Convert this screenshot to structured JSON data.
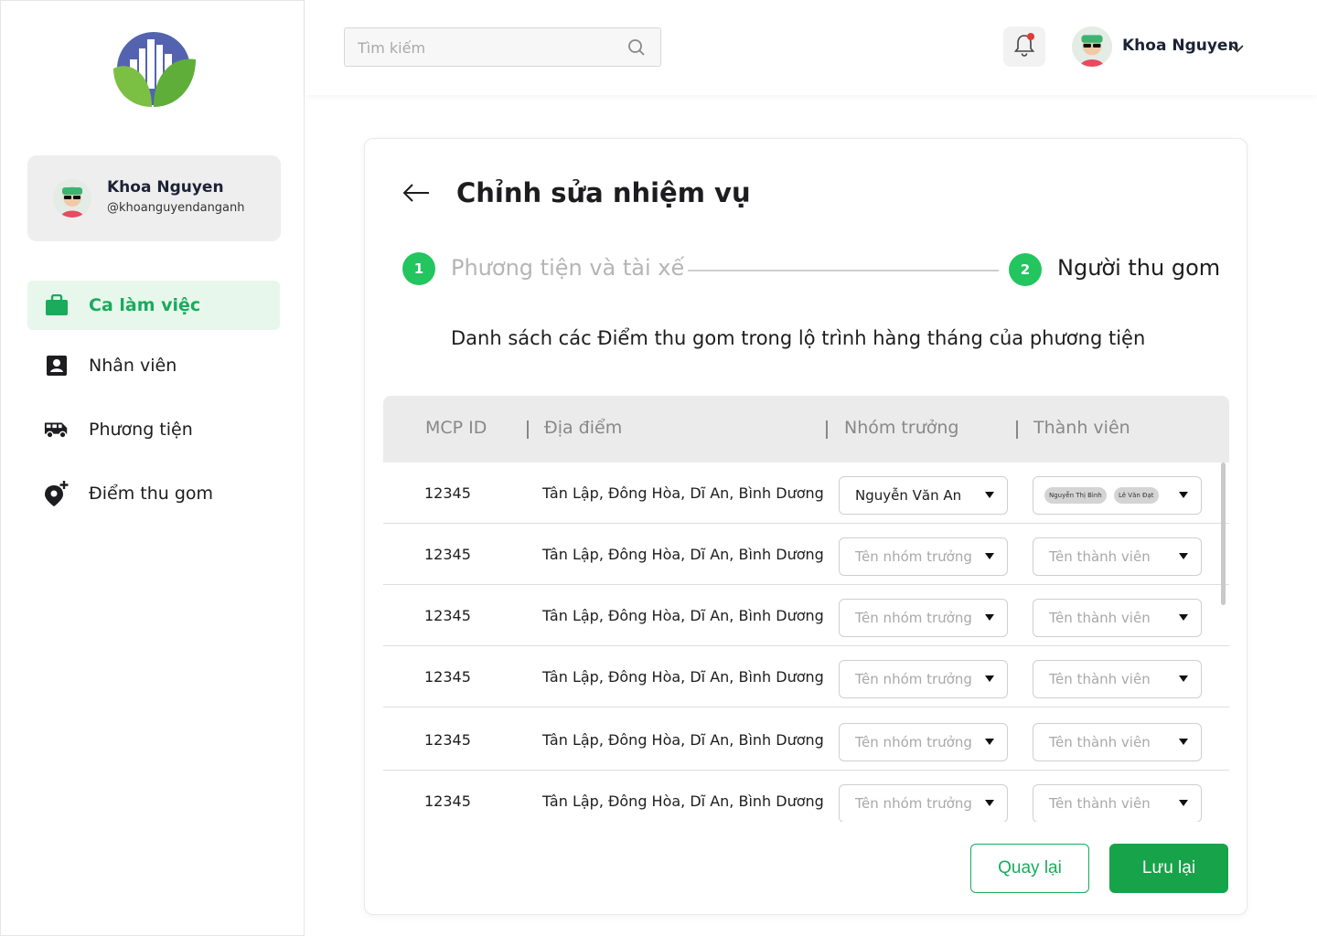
{
  "sidebar": {
    "profile": {
      "name": "Khoa Nguyen",
      "handle": "@khoanguyendanganh"
    },
    "items": [
      {
        "label": "Ca làm việc",
        "icon": "briefcase-icon",
        "active": true
      },
      {
        "label": "Nhân viên",
        "icon": "contact-card-icon",
        "active": false
      },
      {
        "label": "Phương tiện",
        "icon": "bus-icon",
        "active": false
      },
      {
        "label": "Điểm thu gom",
        "icon": "add-location-icon",
        "active": false
      }
    ]
  },
  "header": {
    "search_placeholder": "Tìm kiếm",
    "user_name": "Khoa Nguyen"
  },
  "page": {
    "title": "Chỉnh sửa nhiệm vụ",
    "steps": [
      {
        "number": "1",
        "label": "Phương tiện và tài xế",
        "current": false
      },
      {
        "number": "2",
        "label": "Người thu gom",
        "current": true
      }
    ],
    "subtitle": "Danh sách các Điểm thu gom trong lộ trình hàng tháng của phương tiện"
  },
  "table": {
    "headers": [
      "MCP ID",
      "Địa điểm",
      "Nhóm trưởng",
      "Thành viên"
    ],
    "leader_placeholder": "Tên nhóm trưởng",
    "member_placeholder": "Tên thành viên",
    "rows": [
      {
        "id": "12345",
        "location": "Tân Lập, Đông Hòa, Dĩ An, Bình Dương",
        "leader": "Nguyễn Văn An",
        "members": [
          "Nguyễn Thị Bình",
          "Lê Văn Đạt"
        ]
      },
      {
        "id": "12345",
        "location": "Tân Lập, Đông Hòa, Dĩ An, Bình Dương",
        "leader": "",
        "members": []
      },
      {
        "id": "12345",
        "location": "Tân Lập, Đông Hòa, Dĩ An, Bình Dương",
        "leader": "",
        "members": []
      },
      {
        "id": "12345",
        "location": "Tân Lập, Đông Hòa, Dĩ An, Bình Dương",
        "leader": "",
        "members": []
      },
      {
        "id": "12345",
        "location": "Tân Lập, Đông Hòa, Dĩ An, Bình Dương",
        "leader": "",
        "members": []
      },
      {
        "id": "12345",
        "location": "Tân Lập, Đông Hòa, Dĩ An, Bình Dương",
        "leader": "",
        "members": []
      }
    ]
  },
  "actions": {
    "back_label": "Quay lại",
    "save_label": "Lưu lại"
  },
  "colors": {
    "accent": "#16a34a",
    "accent_light": "#e7f7ec",
    "step": "#22c55e",
    "notification": "#e53935"
  }
}
